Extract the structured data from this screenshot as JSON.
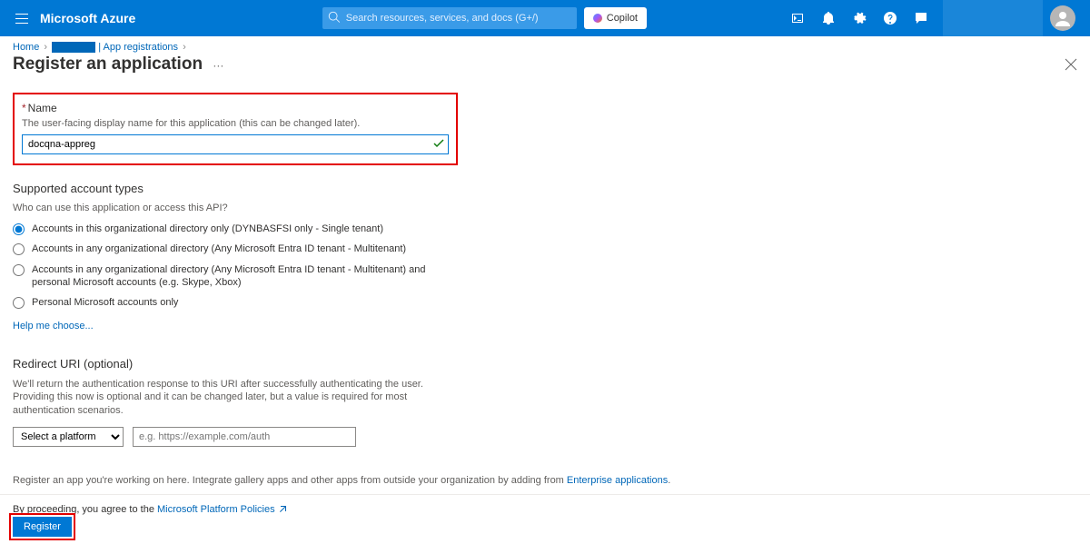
{
  "topbar": {
    "brand": "Microsoft Azure",
    "search_placeholder": "Search resources, services, and docs (G+/)",
    "copilot": "Copilot"
  },
  "breadcrumb": {
    "home": "Home",
    "app_reg": "| App registrations"
  },
  "header": {
    "title": "Register an application"
  },
  "name_field": {
    "label": "Name",
    "help": "The user-facing display name for this application (this can be changed later).",
    "value": "docqna-appreg"
  },
  "account_types": {
    "title": "Supported account types",
    "subtitle": "Who can use this application or access this API?",
    "options": [
      "Accounts in this organizational directory only (DYNBASFSI only - Single tenant)",
      "Accounts in any organizational directory (Any Microsoft Entra ID tenant - Multitenant)",
      "Accounts in any organizational directory (Any Microsoft Entra ID tenant - Multitenant) and personal Microsoft accounts (e.g. Skype, Xbox)",
      "Personal Microsoft accounts only"
    ],
    "help_link": "Help me choose..."
  },
  "redirect": {
    "title": "Redirect URI (optional)",
    "desc": "We'll return the authentication response to this URI after successfully authenticating the user. Providing this now is optional and it can be changed later, but a value is required for most authentication scenarios.",
    "platform_placeholder": "Select a platform",
    "uri_placeholder": "e.g. https://example.com/auth"
  },
  "footer": {
    "note_prefix": "Register an app you're working on here. Integrate gallery apps and other apps from outside your organization by adding from ",
    "note_link": "Enterprise applications",
    "policy_prefix": "By proceeding, you agree to the ",
    "policy_link": "Microsoft Platform Policies",
    "register": "Register"
  }
}
